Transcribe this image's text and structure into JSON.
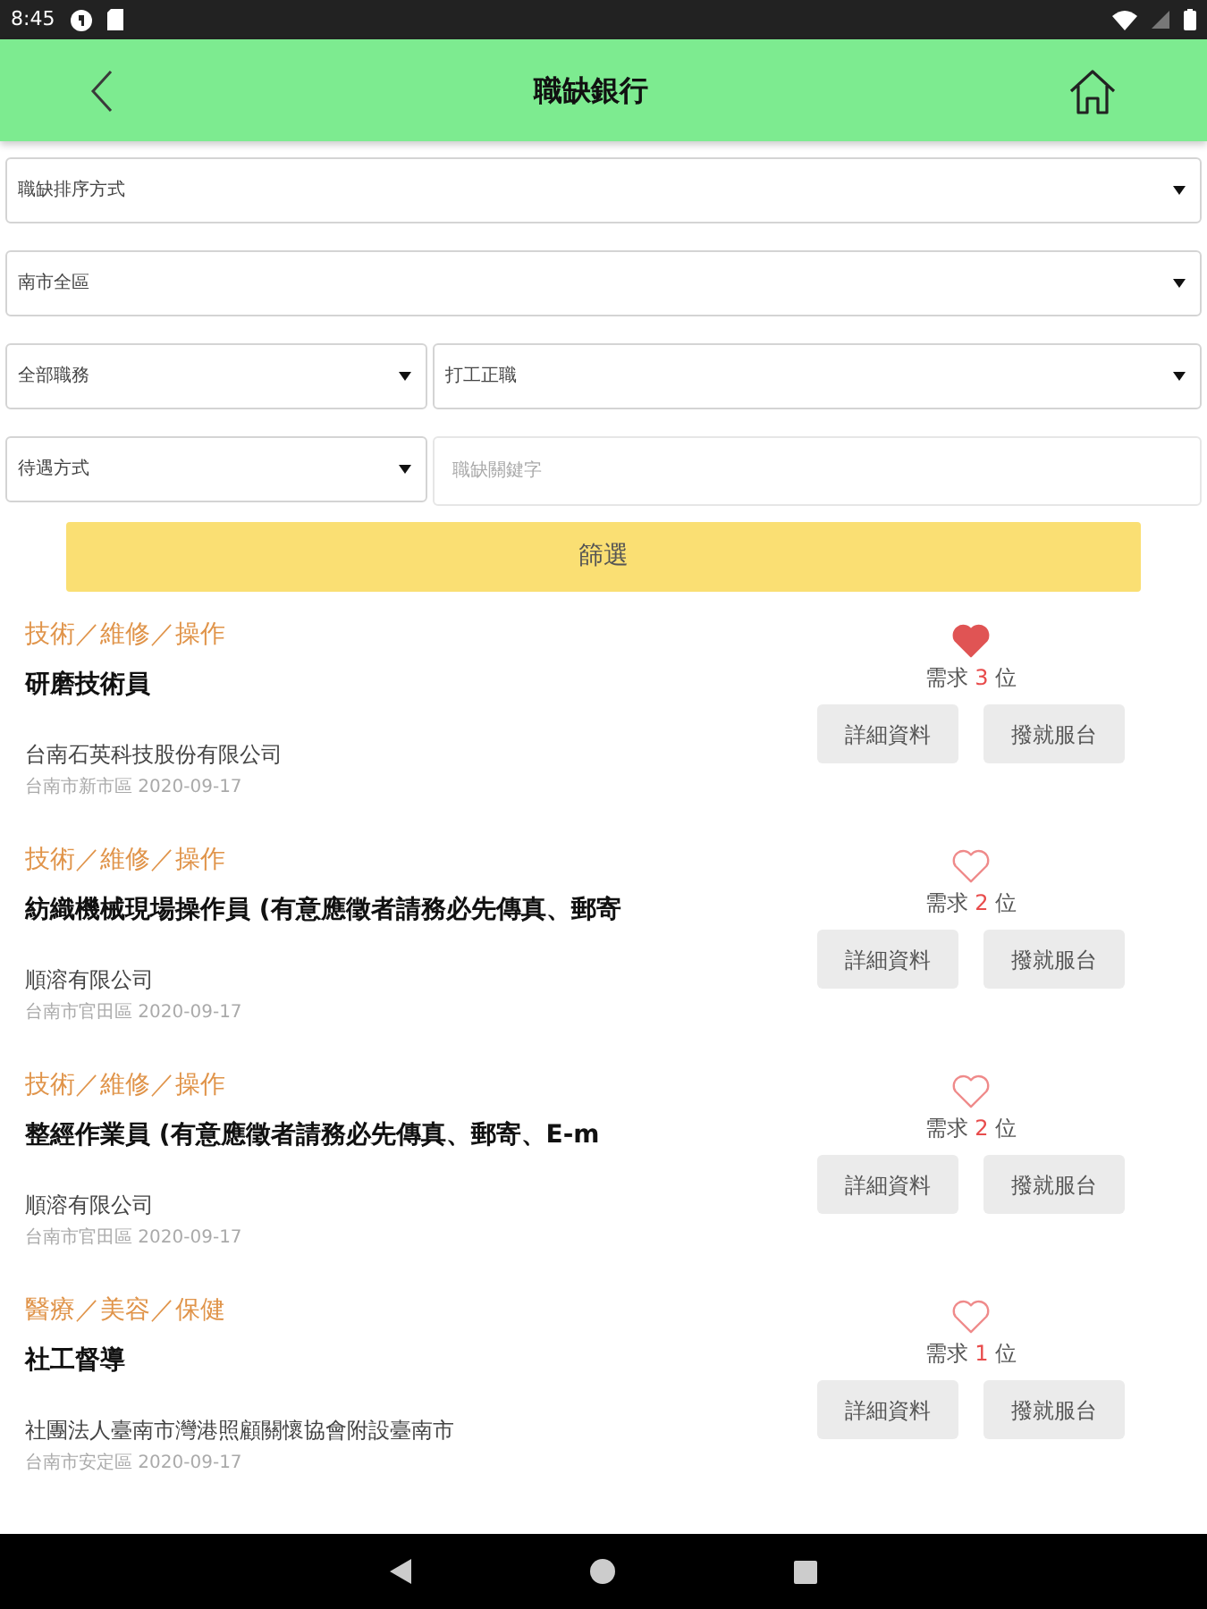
{
  "status_bar": {
    "time": "8:45"
  },
  "header": {
    "title": "職缺銀行"
  },
  "filters": {
    "sort": "職缺排序方式",
    "area": "南市全區",
    "category": "全部職務",
    "job_type": "打工正職",
    "pay": "待遇方式",
    "keyword_placeholder": "職缺關鍵字",
    "submit": "篩選"
  },
  "jobs": [
    {
      "category": "技術／維修／操作",
      "title": "研磨技術員",
      "company": "台南石英科技股份有限公司",
      "location": "台南市新市區 2020-09-17",
      "favorite": true,
      "need_prefix": "需求",
      "need_count": "3",
      "need_suffix": "位",
      "details": "詳細資料",
      "service": "撥就服台"
    },
    {
      "category": "技術／維修／操作",
      "title": "紡織機械現場操作員 (有意應徵者請務必先傳真、郵寄",
      "company": "順溶有限公司",
      "location": "台南市官田區 2020-09-17",
      "favorite": false,
      "need_prefix": "需求",
      "need_count": "2",
      "need_suffix": "位",
      "details": "詳細資料",
      "service": "撥就服台"
    },
    {
      "category": "技術／維修／操作",
      "title": "整經作業員 (有意應徵者請務必先傳真、郵寄、E-m",
      "company": "順溶有限公司",
      "location": "台南市官田區 2020-09-17",
      "favorite": false,
      "need_prefix": "需求",
      "need_count": "2",
      "need_suffix": "位",
      "details": "詳細資料",
      "service": "撥就服台"
    },
    {
      "category": "醫療／美容／保健",
      "title": "社工督導",
      "company": "社團法人臺南市灣港照顧關懷協會附設臺南市",
      "location": "台南市安定區 2020-09-17",
      "favorite": false,
      "need_prefix": "需求",
      "need_count": "1",
      "need_suffix": "位",
      "details": "詳細資料",
      "service": "撥就服台"
    }
  ]
}
